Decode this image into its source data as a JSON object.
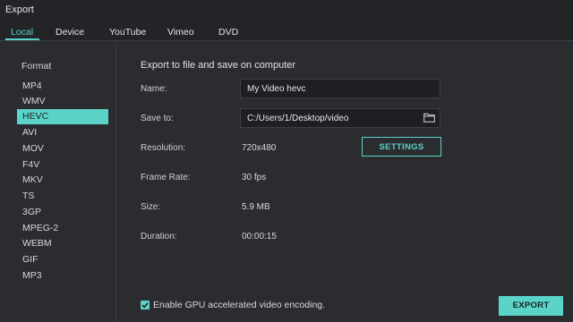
{
  "window": {
    "title": "Export"
  },
  "tabs": [
    {
      "label": "Local",
      "active": true
    },
    {
      "label": "Device"
    },
    {
      "label": "YouTube"
    },
    {
      "label": "Vimeo"
    },
    {
      "label": "DVD"
    }
  ],
  "sidebar": {
    "title": "Format",
    "selected": "HEVC",
    "items": [
      "MP4",
      "WMV",
      "HEVC",
      "AVI",
      "MOV",
      "F4V",
      "MKV",
      "TS",
      "3GP",
      "MPEG-2",
      "WEBM",
      "GIF",
      "MP3"
    ]
  },
  "main": {
    "heading": "Export to file and save on computer",
    "name_label": "Name:",
    "name_value": "My Video hevc",
    "save_to_label": "Save to:",
    "save_to_value": "C:/Users/1/Desktop/video",
    "resolution_label": "Resolution:",
    "resolution_value": "720x480",
    "settings_button": "SETTINGS",
    "frame_rate_label": "Frame Rate:",
    "frame_rate_value": "30 fps",
    "size_label": "Size:",
    "size_value": "5.9 MB",
    "duration_label": "Duration:",
    "duration_value": "00:00:15",
    "gpu_label": "Enable GPU accelerated video encoding.",
    "gpu_checked": true,
    "export_button": "EXPORT"
  },
  "colors": {
    "accent": "#5ad3c8",
    "background": "#2a2c30",
    "header": "#232428",
    "field": "#1e1f23"
  },
  "icons": {
    "folder": "folder-icon",
    "checkbox": "checkmark-icon"
  }
}
